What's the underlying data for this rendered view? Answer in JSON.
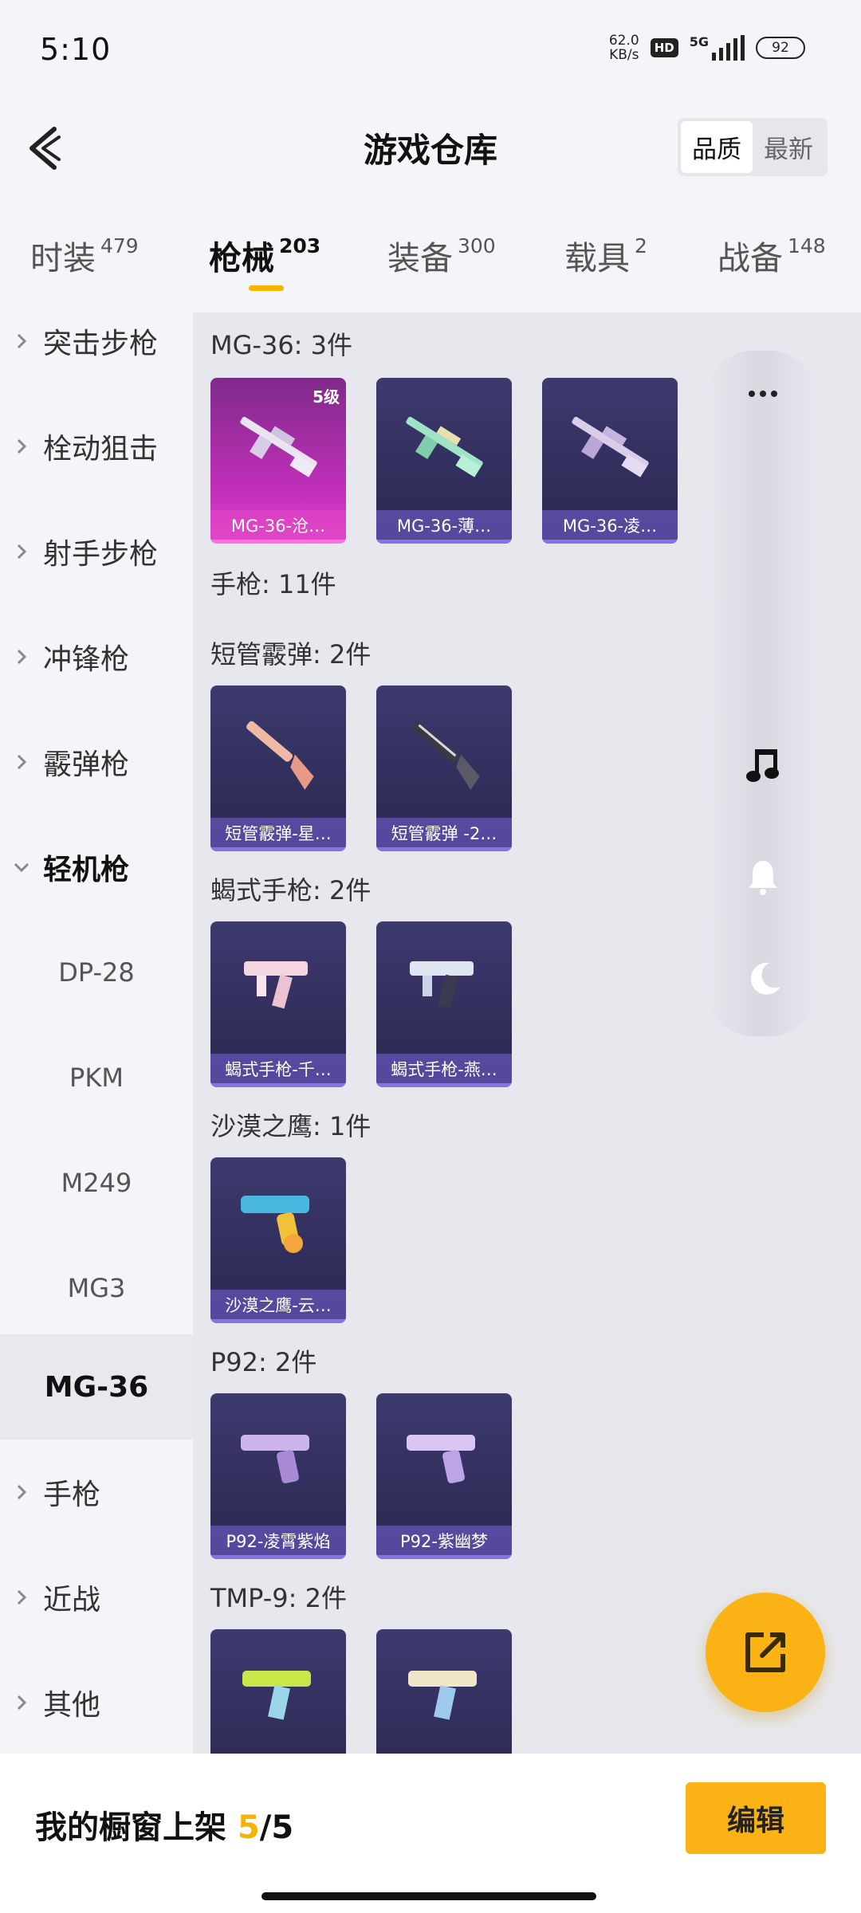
{
  "status_bar": {
    "time": "5:10",
    "net_speed_value": "62.0",
    "net_speed_unit": "KB/s",
    "hd_badge": "HD",
    "network": "5G",
    "battery": "92"
  },
  "header": {
    "title": "游戏仓库",
    "sort_options": [
      "品质",
      "最新"
    ],
    "active_sort": "品质"
  },
  "tabs": [
    {
      "label": "时装",
      "count": "479",
      "active": false
    },
    {
      "label": "枪械",
      "count": "203",
      "active": true
    },
    {
      "label": "装备",
      "count": "300",
      "active": false
    },
    {
      "label": "载具",
      "count": "2",
      "active": false
    },
    {
      "label": "战备",
      "count": "148",
      "active": false
    }
  ],
  "accent_color": "#f5b400",
  "sidebar": {
    "items": [
      {
        "label": "突击步枪",
        "expanded": false
      },
      {
        "label": "栓动狙击",
        "expanded": false
      },
      {
        "label": "射手步枪",
        "expanded": false
      },
      {
        "label": "冲锋枪",
        "expanded": false
      },
      {
        "label": "霰弹枪",
        "expanded": false
      },
      {
        "label": "轻机枪",
        "expanded": true
      }
    ],
    "subitems": [
      "DP-28",
      "PKM",
      "M249",
      "MG3",
      "MG-36"
    ],
    "selected_subitem": "MG-36",
    "items_after": [
      {
        "label": "手枪"
      },
      {
        "label": "近战"
      },
      {
        "label": "其他"
      }
    ]
  },
  "content": {
    "groups": [
      {
        "title": "MG-36: 3件",
        "cards": [
          {
            "name": "MG-36-沧…",
            "rarity": "epic",
            "level": "5级"
          },
          {
            "name": "MG-36-薄…",
            "rarity": "rare"
          },
          {
            "name": "MG-36-凌…",
            "rarity": "rare"
          }
        ]
      },
      {
        "title": "手枪: 11件",
        "cards": []
      },
      {
        "title": "短管霰弹: 2件",
        "cards": [
          {
            "name": "短管霰弹-星…",
            "rarity": "rare"
          },
          {
            "name": "短管霰弹 -2…",
            "rarity": "rare"
          }
        ]
      },
      {
        "title": "蝎式手枪: 2件",
        "cards": [
          {
            "name": "蝎式手枪-千…",
            "rarity": "rare"
          },
          {
            "name": "蝎式手枪-燕…",
            "rarity": "rare"
          }
        ]
      },
      {
        "title": "沙漠之鹰: 1件",
        "cards": [
          {
            "name": "沙漠之鹰-云…",
            "rarity": "rare"
          }
        ]
      },
      {
        "title": "P92: 2件",
        "cards": [
          {
            "name": "P92-凌霄紫焰",
            "rarity": "rare"
          },
          {
            "name": "P92-紫幽梦",
            "rarity": "rare"
          }
        ]
      },
      {
        "title": "TMP-9: 2件",
        "cards": [
          {
            "rarity": "rare"
          },
          {
            "rarity": "rare"
          }
        ]
      }
    ]
  },
  "dock": {
    "icons": [
      "more-icon",
      "music-icon",
      "bell-icon",
      "moon-icon"
    ]
  },
  "bottom_bar": {
    "showcase_label": "我的橱窗上架",
    "showcase_current": "5",
    "showcase_separator": "/",
    "showcase_total": "5",
    "edit_label": "编辑"
  }
}
